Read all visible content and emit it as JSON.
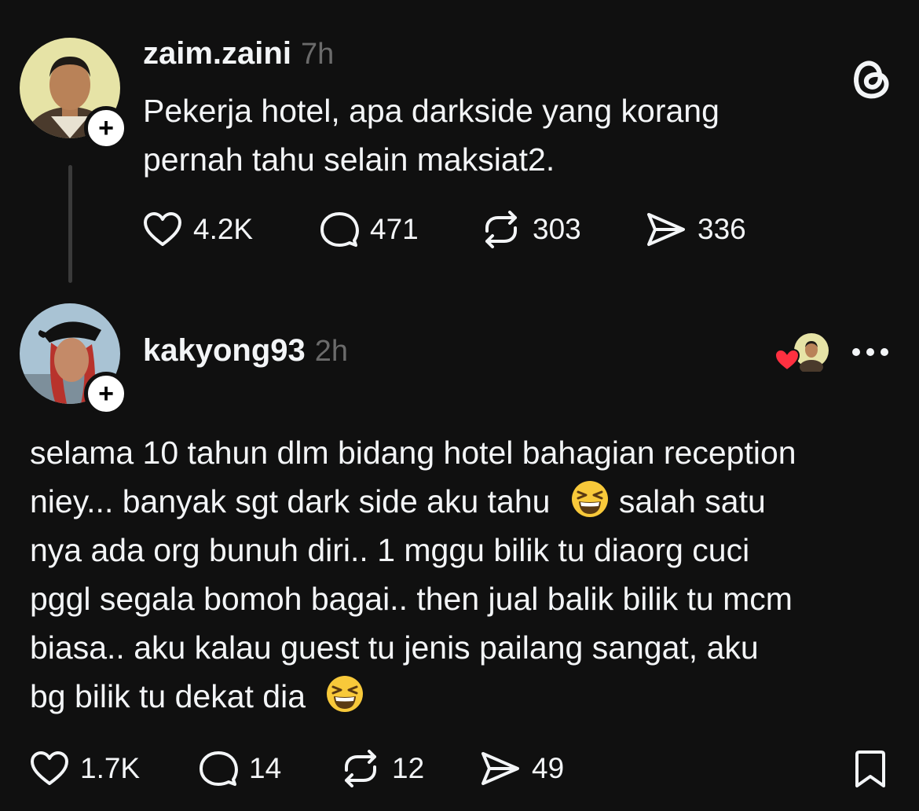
{
  "post": {
    "username": "zaim.zaini",
    "time": "7h",
    "text_line1": "Pekerja hotel, apa darkside yang korang",
    "text_line2": "pernah tahu selain maksiat2.",
    "likes": "4.2K",
    "replies": "471",
    "reposts": "303",
    "shares": "336"
  },
  "reply": {
    "username": "kakyong93",
    "time": "2h",
    "lines": [
      "selama 10 tahun dlm bidang hotel bahagian reception",
      "niey... banyak sgt dark side aku tahu",
      "salah satu",
      "nya ada org bunuh diri.. 1 mggu bilik tu diaorg cuci",
      "pggl segala bomoh bagai.. then jual balik bilik tu mcm",
      "biasa.. aku kalau guest tu jenis pailang sangat, aku",
      "bg bilik tu dekat dia"
    ],
    "likes": "1.7K",
    "replies": "14",
    "reposts": "12",
    "shares": "49"
  },
  "icons": {
    "app_logo": "threads-logo-icon",
    "like": "heart-icon",
    "reply": "comment-bubble-icon",
    "repost": "repost-icon",
    "share": "send-icon",
    "more": "more-dots-icon",
    "save": "bookmark-icon",
    "emoji": "laughing-emoji"
  },
  "colors": {
    "background": "#101010",
    "text": "#f3f5f7",
    "muted": "#6b6b6b",
    "heart_badge": "#ff3040"
  }
}
